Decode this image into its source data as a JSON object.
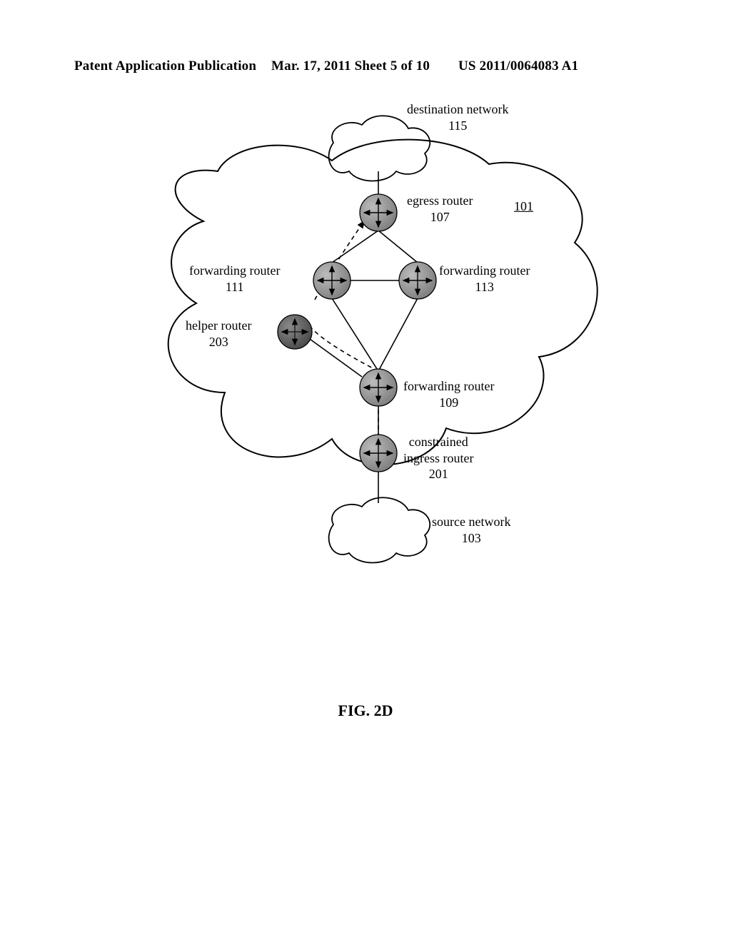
{
  "header": {
    "left": "Patent Application Publication",
    "mid": "Mar. 17, 2011  Sheet 5 of 10",
    "right": "US 2011/0064083 A1"
  },
  "figure_label": "FIG. 2D",
  "labels": {
    "dest_net": "destination network\n115",
    "egress": "egress router\n107",
    "domain_ref": "101",
    "fwd_111": "forwarding router\n111",
    "fwd_113": "forwarding router\n113",
    "helper": "helper router\n203",
    "fwd_109": "forwarding router\n109",
    "ingress": "constrained\ningress router\n201",
    "src_net": "source network\n103"
  }
}
